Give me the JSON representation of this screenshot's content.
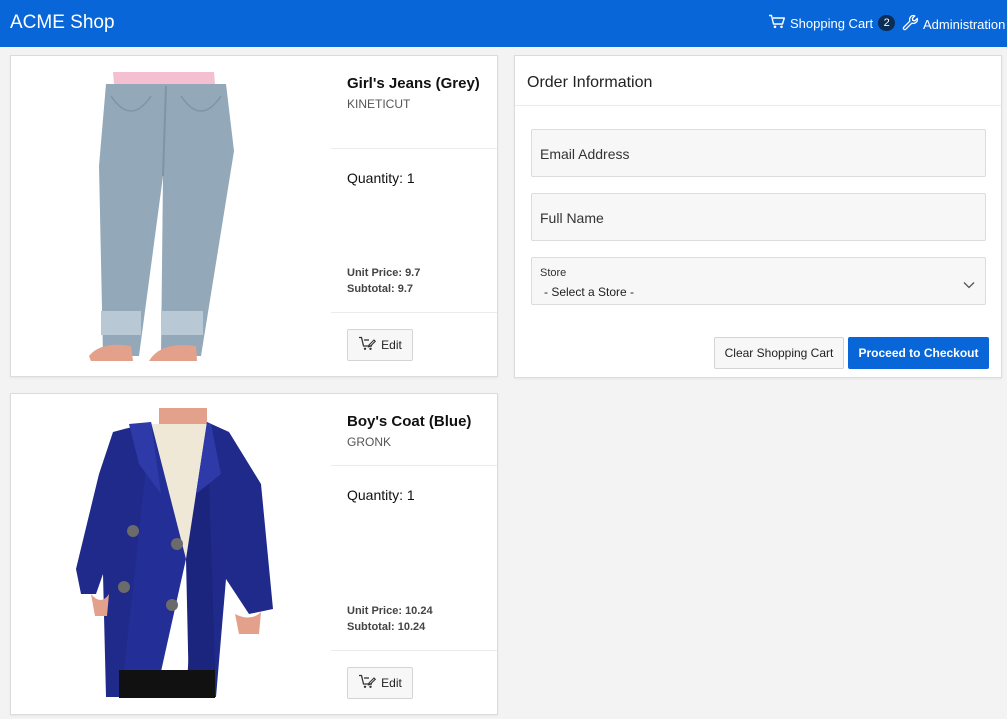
{
  "header": {
    "app_title": "ACME Shop",
    "cart_label": "Shopping Cart",
    "cart_count": "2",
    "admin_label": "Administration"
  },
  "products": [
    {
      "name": "Girl's Jeans (Grey)",
      "brand": "KINETICUT",
      "quantity_text": "Quantity: 1",
      "unit_price_text": "Unit Price: 9.7",
      "subtotal_text": "Subtotal: 9.7",
      "edit_label": "Edit"
    },
    {
      "name": "Boy's Coat (Blue)",
      "brand": "GRONK",
      "quantity_text": "Quantity: 1",
      "unit_price_text": "Unit Price: 10.24",
      "subtotal_text": "Subtotal: 10.24",
      "edit_label": "Edit"
    }
  ],
  "order": {
    "title": "Order Information",
    "email_label": "Email Address",
    "name_label": "Full Name",
    "store_label": "Store",
    "store_value": "- Select a Store -",
    "clear_label": "Clear Shopping Cart",
    "checkout_label": "Proceed to Checkout"
  },
  "colors": {
    "primary": "#0866d8",
    "badge": "#0b2d56",
    "jeans": "#93a8b8",
    "coat": "#1f2a8a"
  },
  "icons": {
    "cart": "shopping-cart-icon",
    "admin": "wrench-icon",
    "edit": "cart-edit-icon",
    "select": "chevron-down-icon"
  }
}
